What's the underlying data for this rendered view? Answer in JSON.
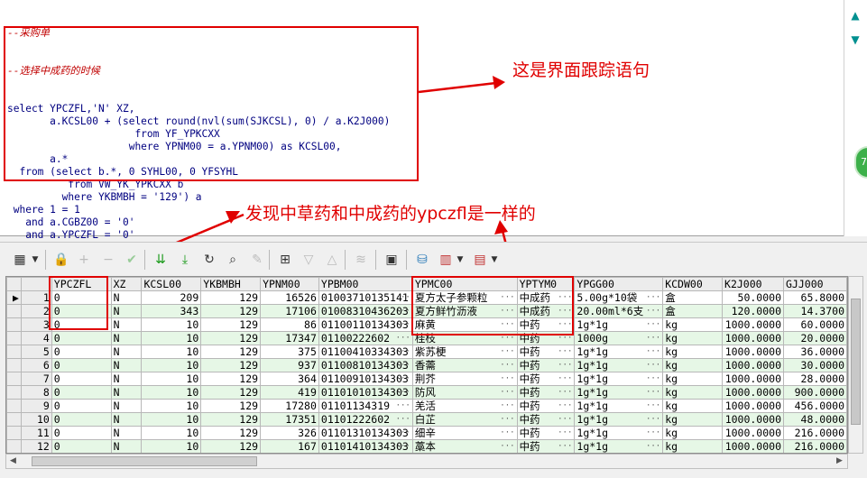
{
  "sql": {
    "comment1": "--采购单",
    "comment2": "--选择中成药的时候",
    "lines": [
      "select YPCZFL,'N' XZ,",
      "       a.KCSL00 + (select round(nvl(sum(SJKCSL), 0) / a.K2J000)",
      "                     from YF_YPKCXX",
      "                    where YPNM00 = a.YPNM00) as KCSL00,",
      "       a.*",
      "  from (select b.*, 0 SYHL00, 0 YFSYHL",
      "          from VW_YK_YPKCXX b",
      "         where YKBMBH = '129') a",
      " where 1 = 1",
      "   and a.CGBZ00 = '0'",
      "   and a.YPCZFL = '0'",
      " order by a.YLBH00, a.YPBM00;"
    ]
  },
  "annotations": {
    "trace_note": "这是界面跟踪语句",
    "ypczfl_note": "发现中草药和中成药的ypczfl是一样的"
  },
  "side": {
    "up_icon": "▲",
    "down_icon": "▼",
    "badge": "7"
  },
  "toolbar": {
    "icons": [
      "grid-icon",
      "lock-icon",
      "add-icon",
      "remove-icon",
      "check-icon",
      "arrow-down-icon",
      "arrow-down-double-icon",
      "refresh-icon",
      "find-icon",
      "clear-icon",
      "query-icon",
      "filter-icon",
      "up-icon",
      "chart-icon",
      "save-icon",
      "export-icon",
      "bar-chart-icon",
      "table-icon"
    ]
  },
  "grid": {
    "columns": [
      "YPCZFL",
      "XZ",
      "KCSL00",
      "YKBMBH",
      "YPNM00",
      "YPBM00",
      "YPMC00",
      "YPTYM0",
      "YPGG00",
      "KCDW00",
      "K2J000",
      "GJJ000"
    ],
    "rows": [
      [
        "0",
        "N",
        "209",
        "129",
        "16526",
        "01003710135141",
        "夏方太子参颗粒",
        "中成药",
        "5.00g*10袋",
        "盒",
        "50.0000",
        "65.8000"
      ],
      [
        "0",
        "N",
        "343",
        "129",
        "17106",
        "01008310436203",
        "夏方鲜竹沥液",
        "中成药",
        "20.00ml*6支",
        "盒",
        "120.0000",
        "14.3700"
      ],
      [
        "0",
        "N",
        "10",
        "129",
        "86",
        "01100110134303",
        "麻黄",
        "中药",
        "1g*1g",
        "kg",
        "1000.0000",
        "60.0000"
      ],
      [
        "0",
        "N",
        "10",
        "129",
        "17347",
        "01100222602",
        "桂枝",
        "中药",
        "1000g",
        "kg",
        "1000.0000",
        "20.0000"
      ],
      [
        "0",
        "N",
        "10",
        "129",
        "375",
        "01100410334303",
        "紫苏梗",
        "中药",
        "1g*1g",
        "kg",
        "1000.0000",
        "36.0000"
      ],
      [
        "0",
        "N",
        "10",
        "129",
        "937",
        "01100810134303",
        "香薷",
        "中药",
        "1g*1g",
        "kg",
        "1000.0000",
        "30.0000"
      ],
      [
        "0",
        "N",
        "10",
        "129",
        "364",
        "01100910134303",
        "荆芥",
        "中药",
        "1g*1g",
        "kg",
        "1000.0000",
        "28.0000"
      ],
      [
        "0",
        "N",
        "10",
        "129",
        "419",
        "01101010134303",
        "防风",
        "中药",
        "1g*1g",
        "kg",
        "1000.0000",
        "900.0000"
      ],
      [
        "0",
        "N",
        "10",
        "129",
        "17280",
        "01101134319",
        "羌活",
        "中药",
        "1g*1g",
        "kg",
        "1000.0000",
        "456.0000"
      ],
      [
        "0",
        "N",
        "10",
        "129",
        "17351",
        "01101222602",
        "白芷",
        "中药",
        "1g*1g",
        "kg",
        "1000.0000",
        "48.0000"
      ],
      [
        "0",
        "N",
        "10",
        "129",
        "326",
        "01101310134303",
        "细辛",
        "中药",
        "1g*1g",
        "kg",
        "1000.0000",
        "216.0000"
      ],
      [
        "0",
        "N",
        "10",
        "129",
        "167",
        "01101410134303",
        "藁本",
        "中药",
        "1g*1g",
        "kg",
        "1000.0000",
        "216.0000"
      ]
    ],
    "row_numbers": [
      "1",
      "2",
      "3",
      "4",
      "5",
      "6",
      "7",
      "8",
      "9",
      "10",
      "11",
      "12"
    ],
    "current_row_marker": "▶",
    "ellipsis": "···"
  }
}
